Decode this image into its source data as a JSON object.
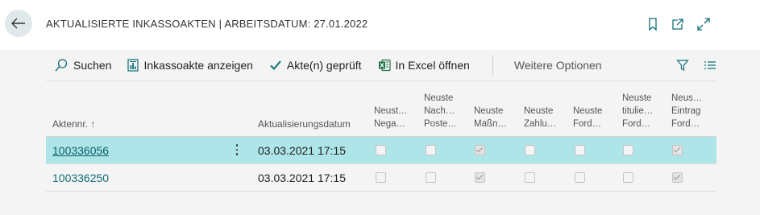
{
  "header": {
    "title": "AKTUALISIERTE INKASSOAKTEN | ARBEITSDATUM: 27.01.2022",
    "icons": [
      "back-arrow-icon",
      "bookmark-icon",
      "open-new-window-icon",
      "expand-icon"
    ]
  },
  "toolbar": {
    "search_label": "Suchen",
    "show_file_label": "Inkassoakte anzeigen",
    "checked_label": "Akte(n) geprüft",
    "excel_label": "In Excel öffnen",
    "more_label": "Weitere Optionen"
  },
  "columns": {
    "aktennr": "Aktennr. ↑",
    "datum": "Aktualisierungsdatum",
    "c1": [
      "Neust…",
      "Nega…"
    ],
    "c2": [
      "Neuste",
      "Nach…",
      "Poste…"
    ],
    "c3": [
      "Neuste",
      "Maßn…"
    ],
    "c4": [
      "Neuste",
      "Zahlu…"
    ],
    "c5": [
      "Neuste",
      "Ford…"
    ],
    "c6": [
      "Neuste",
      "titulie…",
      "Ford…"
    ],
    "c7": [
      "Neus…",
      "Eintrag",
      "Ford…"
    ]
  },
  "rows": [
    {
      "aktennr": "100336056",
      "datum": "03.03.2021 17:15",
      "checks": [
        false,
        false,
        true,
        false,
        false,
        false,
        true
      ],
      "selected": true
    },
    {
      "aktennr": "100336250",
      "datum": "03.03.2021 17:15",
      "checks": [
        false,
        false,
        true,
        false,
        false,
        false,
        true
      ],
      "selected": false
    }
  ],
  "colors": {
    "accent": "#0f6f78",
    "selected_row": "#aee5e8",
    "excel_green": "#1e7145"
  }
}
